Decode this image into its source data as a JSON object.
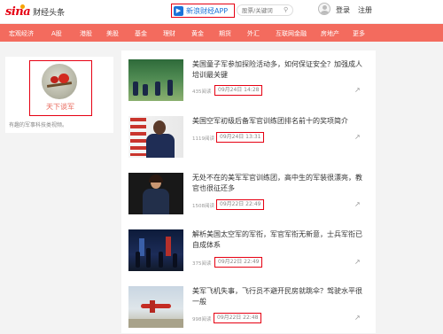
{
  "header": {
    "logo_brand": "sina",
    "logo_text": "财经头条",
    "app_button_label": "新浪财经APP",
    "search_placeholder": "股票/关键词",
    "search_icon": "magnifier",
    "login": "登录",
    "register": "注册"
  },
  "nav": {
    "items": [
      "宏观经济",
      "A股",
      "港股",
      "美股",
      "基金",
      "理财",
      "黄金",
      "期货",
      "外汇",
      "互联网金融",
      "房地产",
      "更多"
    ]
  },
  "profile": {
    "name": "天下谈军",
    "description": "有趣的军事科技类视频。"
  },
  "feed": {
    "items": [
      {
        "title": "美国童子军参加探险活动多，如何保证安全？加强成人培训最关键",
        "reads": "435阅读",
        "date": "09月24日 14:28"
      },
      {
        "title": "美国空军初级后备军官训练团排名前十的奖项简介",
        "reads": "1119阅读",
        "date": "09月24日 13:31"
      },
      {
        "title": "无处不在的美军军官训练团，高中生的军装很漂亮，教官也很征还多",
        "reads": "1508阅读",
        "date": "09月22日 22:49"
      },
      {
        "title": "解析美国太空军的军衔，军官军衔无新意，士兵军衔已自成体系",
        "reads": "375阅读",
        "date": "09月22日 22:49"
      },
      {
        "title": "美军飞机失事，飞行员不避开民房就跳伞？驾驶水平很一般",
        "reads": "998阅读",
        "date": "09月22日 22:48"
      }
    ]
  },
  "colors": {
    "brand_red": "#e60012",
    "nav_bg": "#f36b5e",
    "highlight_border": "#e60012",
    "app_blue": "#1a73d9"
  }
}
